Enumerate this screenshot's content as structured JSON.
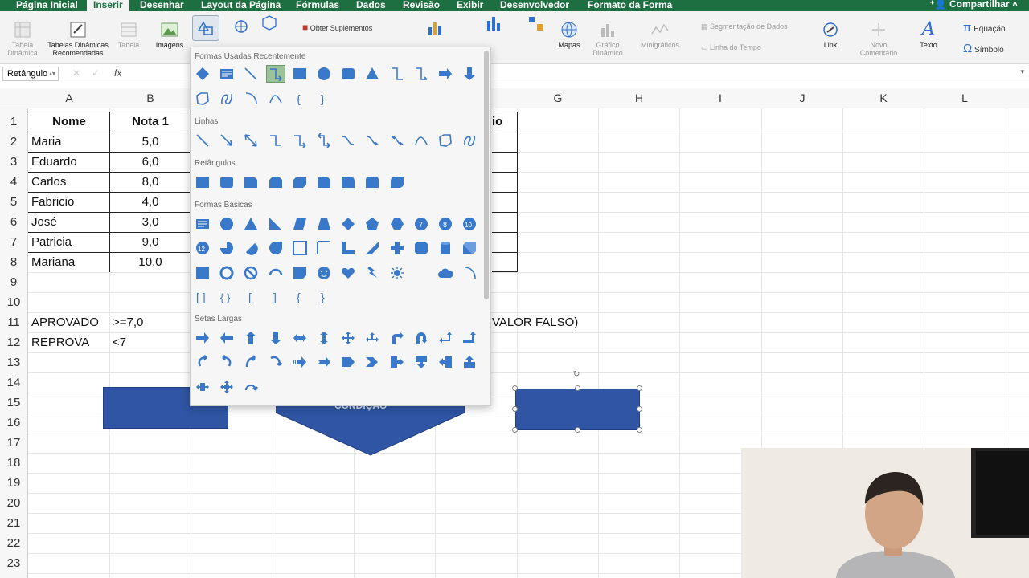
{
  "tabs": [
    {
      "label": "Página Inicial"
    },
    {
      "label": "Inserir"
    },
    {
      "label": "Desenhar"
    },
    {
      "label": "Layout da Página"
    },
    {
      "label": "Fórmulas"
    },
    {
      "label": "Dados"
    },
    {
      "label": "Revisão"
    },
    {
      "label": "Exibir"
    },
    {
      "label": "Desenvolvedor"
    },
    {
      "label": "Formato da Forma"
    }
  ],
  "share_label": "Compartilhar",
  "ribbon": {
    "tabela_dinamica": "Tabela Dinâmica",
    "tabelas_recomendadas": "Tabelas Dinâmicas Recomendadas",
    "tabela": "Tabela",
    "imagens": "Imagens",
    "obter_suplementos": "Obter Suplementos",
    "mapas": "Mapas",
    "grafico_dinamico": "Gráfico Dinâmico",
    "minigraficos": "Minigráficos",
    "segmentacao": "Segmentação de Dados",
    "linha_tempo": "Linha do Tempo",
    "link": "Link",
    "novo_comentario": "Novo Comentário",
    "texto": "Texto",
    "equacao": "Equação",
    "simbolo": "Símbolo"
  },
  "formula_bar": {
    "name_box": "Retângulo",
    "fx": "fx"
  },
  "columns": [
    "A",
    "B",
    "G",
    "H",
    "I",
    "J",
    "K",
    "L"
  ],
  "rows": [
    "1",
    "2",
    "3",
    "4",
    "5",
    "6",
    "7",
    "8",
    "9",
    "10",
    "11",
    "12",
    "13",
    "14",
    "15",
    "16",
    "17",
    "18",
    "19",
    "20",
    "21",
    "22",
    "23"
  ],
  "table": {
    "header_nome": "Nome",
    "header_nota": "Nota 1",
    "header_c_fragment": "io",
    "rows": [
      {
        "nome": "Maria",
        "nota": "5,0"
      },
      {
        "nome": "Eduardo",
        "nota": "6,0"
      },
      {
        "nome": "Carlos",
        "nota": "8,0"
      },
      {
        "nome": "Fabricio",
        "nota": "4,0"
      },
      {
        "nome": "José",
        "nota": "3,0"
      },
      {
        "nome": "Patricia",
        "nota": "9,0"
      },
      {
        "nome": "Mariana",
        "nota": "10,0"
      }
    ]
  },
  "criteria": {
    "aprovado_label": "APROVADO",
    "aprovado_rule": ">=7,0",
    "reprova_label": "REPROVA",
    "reprova_rule": "<7",
    "valor_falso_fragment": "VALOR FALSO)"
  },
  "shape_text_fragment": "CONDIÇÃO",
  "shapes_menu": {
    "sections": {
      "recent": "Formas Usadas Recentemente",
      "linhas": "Linhas",
      "retangulos": "Retângulos",
      "basicas": "Formas Básicas",
      "setas": "Setas Largas"
    },
    "icons": {
      "recent_row1": [
        "diamond",
        "text-box",
        "line",
        "elbow-arrow",
        "rectangle",
        "oval",
        "rounded-rectangle",
        "triangle",
        "elbow-connector",
        "elbow-arrow-connector",
        "right-arrow",
        "down-arrow"
      ],
      "recent_row2": [
        "freeform",
        "scribble",
        "arc",
        "curve",
        "left-brace",
        "right-brace"
      ],
      "linhas": [
        "line",
        "line-arrow",
        "line-double-arrow",
        "elbow",
        "elbow-arrow",
        "elbow-double-arrow",
        "curved-connector",
        "curved-arrow",
        "curved-double-arrow",
        "curve",
        "freeform",
        "scribble"
      ],
      "retangulos": [
        "rect",
        "rounded-rect",
        "snip-one-corner",
        "snip-same-side",
        "snip-diagonal",
        "snip-round",
        "round-one-corner",
        "round-same-side",
        "round-diagonal"
      ],
      "basicas_row1": [
        "text-box",
        "oval",
        "triangle",
        "right-triangle",
        "parallelogram",
        "trapezoid",
        "diamond",
        "pentagon",
        "hexagon",
        "heptagon-7",
        "octagon-8",
        "decagon-10"
      ],
      "basicas_row2": [
        "dodecagon-12",
        "pie",
        "chord",
        "teardrop",
        "frame",
        "half-frame",
        "l-shape",
        "diagonal-stripe",
        "cross",
        "plaque",
        "can",
        "cube"
      ],
      "basicas_row3": [
        "bevel",
        "donut",
        "no-symbol",
        "block-arc",
        "folded-corner",
        "smiley",
        "heart",
        "lightning",
        "sun",
        "moon",
        "cloud",
        "arc"
      ],
      "basicas_row4": [
        "double-bracket",
        "double-brace",
        "left-bracket",
        "right-bracket",
        "left-brace",
        "right-brace"
      ],
      "setas_row1": [
        "right-arrow",
        "left-arrow",
        "up-arrow",
        "down-arrow",
        "left-right-arrow",
        "up-down-arrow",
        "quad-arrow",
        "left-right-up-arrow",
        "bent-arrow",
        "u-turn-arrow",
        "left-up-arrow",
        "bent-up-arrow"
      ],
      "setas_row2": [
        "curved-right",
        "curved-left",
        "curved-up",
        "curved-down",
        "striped-right",
        "notched-right",
        "pentagon-arrow",
        "chevron",
        "right-arrow-callout",
        "down-arrow-callout",
        "left-arrow-callout",
        "up-arrow-callout"
      ],
      "setas_row3": [
        "left-right-callout",
        "quad-callout",
        "circular-arrow"
      ]
    }
  },
  "colors": {
    "excel_green": "#1d6f42",
    "shape_blue": "#2f55a4",
    "icon_blue": "#3a78c9"
  }
}
